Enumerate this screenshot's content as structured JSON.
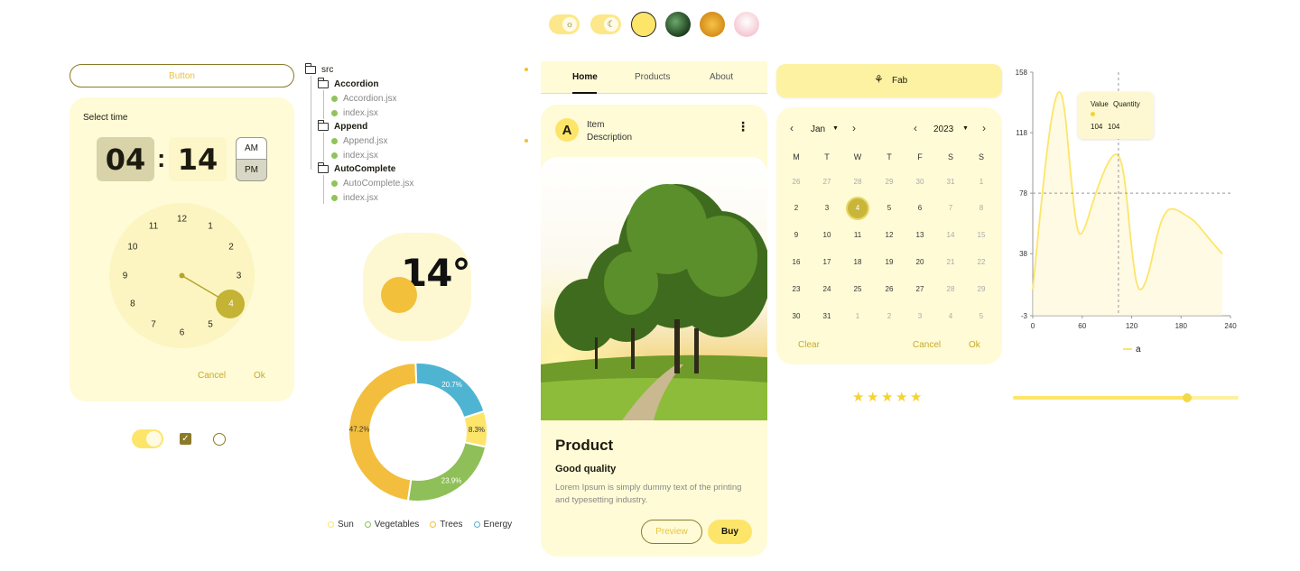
{
  "top_bar": {
    "toggle_light_icon": "sun-icon",
    "toggle_dark_icon": "moon-icon",
    "theme_colors": [
      "#fde56a",
      "#2c5a2c",
      "#e8a92a",
      "#f5c9d2"
    ]
  },
  "button": {
    "label": "Button"
  },
  "time_picker": {
    "label": "Select time",
    "hour": "04",
    "separator": ":",
    "minute": "14",
    "am": "AM",
    "pm": "PM",
    "clock_numbers": [
      "12",
      "1",
      "2",
      "3",
      "4",
      "5",
      "6",
      "7",
      "8",
      "9",
      "10",
      "11"
    ],
    "selected_hour": "4",
    "cancel": "Cancel",
    "ok": "Ok"
  },
  "controls": {
    "switch_on": true,
    "checkbox_checked": true,
    "radio_checked": false
  },
  "tree": {
    "root": "src",
    "folders": [
      {
        "name": "Accordion",
        "files": [
          "Accordion.jsx",
          "index.jsx"
        ]
      },
      {
        "name": "Append",
        "files": [
          "Append.jsx",
          "index.jsx"
        ]
      },
      {
        "name": "AutoComplete",
        "files": [
          "AutoComplete.jsx",
          "index.jsx"
        ]
      }
    ]
  },
  "weather": {
    "temp": "14°"
  },
  "chart_data": [
    {
      "type": "pie",
      "categories": [
        "Sun",
        "Vegetables",
        "Trees",
        "Energy"
      ],
      "values": [
        8.3,
        23.9,
        47.2,
        20.7
      ],
      "labels": [
        "8.3%",
        "23.9%",
        "47.2%",
        "20.7%"
      ],
      "colors": [
        "#fde56a",
        "#8fbf58",
        "#f3be3d",
        "#4fb4d2"
      ],
      "legend": [
        "Sun",
        "Vegetables",
        "Trees",
        "Energy"
      ]
    },
    {
      "type": "line",
      "series": [
        {
          "name": "a",
          "color": "#fde56a"
        }
      ],
      "xlim": [
        0,
        240
      ],
      "ylim": [
        -3,
        158
      ],
      "xticks": [
        "0",
        "60",
        "120",
        "180",
        "240"
      ],
      "yticks": [
        "158",
        "118",
        "78",
        "38",
        "-3"
      ],
      "tooltip": {
        "col1": "Value",
        "col2": "Quantity",
        "v1": "104",
        "v2": "104"
      },
      "crosshair_x": 104,
      "crosshair_y": 78
    }
  ],
  "tabs": {
    "items": [
      "Home",
      "Products",
      "About"
    ],
    "active": "Home"
  },
  "card": {
    "avatar": "A",
    "item_title": "Item",
    "item_subtitle": "Description",
    "menu_icon": "more-vert-icon",
    "title": "Product",
    "subtitle": "Good quality",
    "body": "Lorem Ipsum is simply dummy text of the printing and typesetting industry.",
    "preview": "Preview",
    "buy": "Buy"
  },
  "fab": {
    "label": "Fab",
    "icon": "plant-icon"
  },
  "calendar": {
    "month": "Jan",
    "year": "2023",
    "weekdays": [
      "M",
      "T",
      "W",
      "T",
      "F",
      "S",
      "S"
    ],
    "weeks": [
      [
        "26",
        "27",
        "28",
        "29",
        "30",
        "31",
        "1"
      ],
      [
        "2",
        "3",
        "4",
        "5",
        "6",
        "7",
        "8"
      ],
      [
        "9",
        "10",
        "11",
        "12",
        "13",
        "14",
        "15"
      ],
      [
        "16",
        "17",
        "18",
        "19",
        "20",
        "21",
        "22"
      ],
      [
        "23",
        "24",
        "25",
        "26",
        "27",
        "28",
        "29"
      ],
      [
        "30",
        "31",
        "1",
        "2",
        "3",
        "4",
        "5"
      ]
    ],
    "selected": "4",
    "clear": "Clear",
    "cancel": "Cancel",
    "ok": "Ok"
  },
  "rating": {
    "value": 5,
    "max": 5
  },
  "slider": {
    "value": 0.77
  }
}
